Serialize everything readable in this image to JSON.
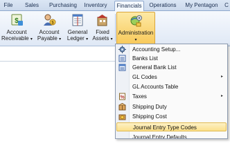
{
  "tabs": [
    {
      "label": "File",
      "active": false
    },
    {
      "label": "Sales",
      "active": false
    },
    {
      "label": "Purchasing",
      "active": false
    },
    {
      "label": "Inventory",
      "active": false
    },
    {
      "label": "Financials",
      "active": true
    },
    {
      "label": "Operations",
      "active": false
    },
    {
      "label": "My Pentagon",
      "active": false
    },
    {
      "label": "C",
      "active": false
    }
  ],
  "ribbon": {
    "buttons": [
      {
        "line1": "Account",
        "line2": "Receivable",
        "icon": "account-receivable-icon"
      },
      {
        "line1": "Account",
        "line2": "Payable",
        "icon": "account-payable-icon"
      },
      {
        "line1": "General",
        "line2": "Ledger",
        "icon": "general-ledger-icon"
      },
      {
        "line1": "Fixed",
        "line2": "Assets",
        "icon": "fixed-assets-icon"
      },
      {
        "line1": "Administration",
        "line2": "",
        "icon": "administration-icon"
      }
    ],
    "dropdown_arrow": "▾"
  },
  "menu": {
    "items": [
      {
        "label": "Accounting Setup...",
        "underline": "",
        "icon": "gear-icon",
        "submenu": false
      },
      {
        "label": "Banks List",
        "icon": "bank-list-icon",
        "submenu": false
      },
      {
        "label": "General Bank List",
        "icon": "general-bank-list-icon",
        "submenu": false
      },
      {
        "label": "GL Codes",
        "icon": "",
        "submenu": true
      },
      {
        "label": "GL Accounts Table",
        "icon": "",
        "submenu": false
      },
      {
        "label": "Taxes",
        "icon": "taxes-icon",
        "submenu": true
      },
      {
        "label": "Shipping Duty",
        "icon": "shipping-duty-icon",
        "submenu": false
      },
      {
        "label": "Shipping Cost",
        "icon": "shipping-cost-icon",
        "submenu": false
      },
      {
        "label": "Journal Entry Type Codes",
        "icon": "",
        "submenu": false,
        "highlighted": true
      },
      {
        "label": "Journal Entry Defaults",
        "icon": "",
        "submenu": false
      }
    ],
    "submenu_arrow": "▸"
  },
  "colors": {
    "accent": "#f8c95a",
    "tab_border": "#8ea8cd",
    "highlight": "#fbe08c"
  }
}
